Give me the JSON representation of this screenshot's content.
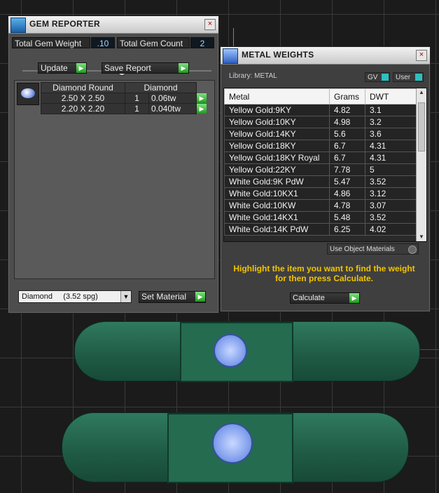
{
  "gem_reporter": {
    "title": "GEM REPORTER",
    "close": "×",
    "total_weight_label": "Total Gem Weight",
    "total_weight_value": ".10",
    "total_count_label": "Total Gem Count",
    "total_count_value": "2",
    "update_label": "Update",
    "save_label": "Save Report",
    "headers": [
      "Diamond Round",
      "Diamond"
    ],
    "rows": [
      {
        "size": "2.50 X 2.50",
        "count": "1",
        "weight": "0.06tw"
      },
      {
        "size": "2.20 X 2.20",
        "count": "1",
        "weight": "0.040tw"
      }
    ],
    "material_select": "Diamond     (3.52 spg)",
    "set_material_label": "Set Material"
  },
  "metal_weights": {
    "title": "METAL WEIGHTS",
    "close": "×",
    "library_label": "Library: METAL",
    "gv_label": "GV",
    "user_label": "User",
    "headers": [
      "Metal",
      "Grams",
      "DWT"
    ],
    "rows": [
      {
        "metal": "Yellow Gold:9KY",
        "grams": "4.82",
        "dwt": "3.1"
      },
      {
        "metal": "Yellow Gold:10KY",
        "grams": "4.98",
        "dwt": "3.2"
      },
      {
        "metal": "Yellow Gold:14KY",
        "grams": "5.6",
        "dwt": "3.6"
      },
      {
        "metal": "Yellow Gold:18KY",
        "grams": "6.7",
        "dwt": "4.31"
      },
      {
        "metal": "Yellow Gold:18KY Royal",
        "grams": "6.7",
        "dwt": "4.31"
      },
      {
        "metal": "Yellow Gold:22KY",
        "grams": "7.78",
        "dwt": "5"
      },
      {
        "metal": "White Gold:9K PdW",
        "grams": "5.47",
        "dwt": "3.52"
      },
      {
        "metal": "White Gold:10KX1",
        "grams": "4.86",
        "dwt": "3.12"
      },
      {
        "metal": "White Gold:10KW",
        "grams": "4.78",
        "dwt": "3.07"
      },
      {
        "metal": "White Gold:14KX1",
        "grams": "5.48",
        "dwt": "3.52"
      },
      {
        "metal": "White Gold:14K PdW",
        "grams": "6.25",
        "dwt": "4.02"
      }
    ],
    "use_object_materials": "Use Object Materials",
    "hint_line1": "Highlight the item you want to find the weight",
    "hint_line2": "for then press Calculate.",
    "calculate_label": "Calculate"
  }
}
